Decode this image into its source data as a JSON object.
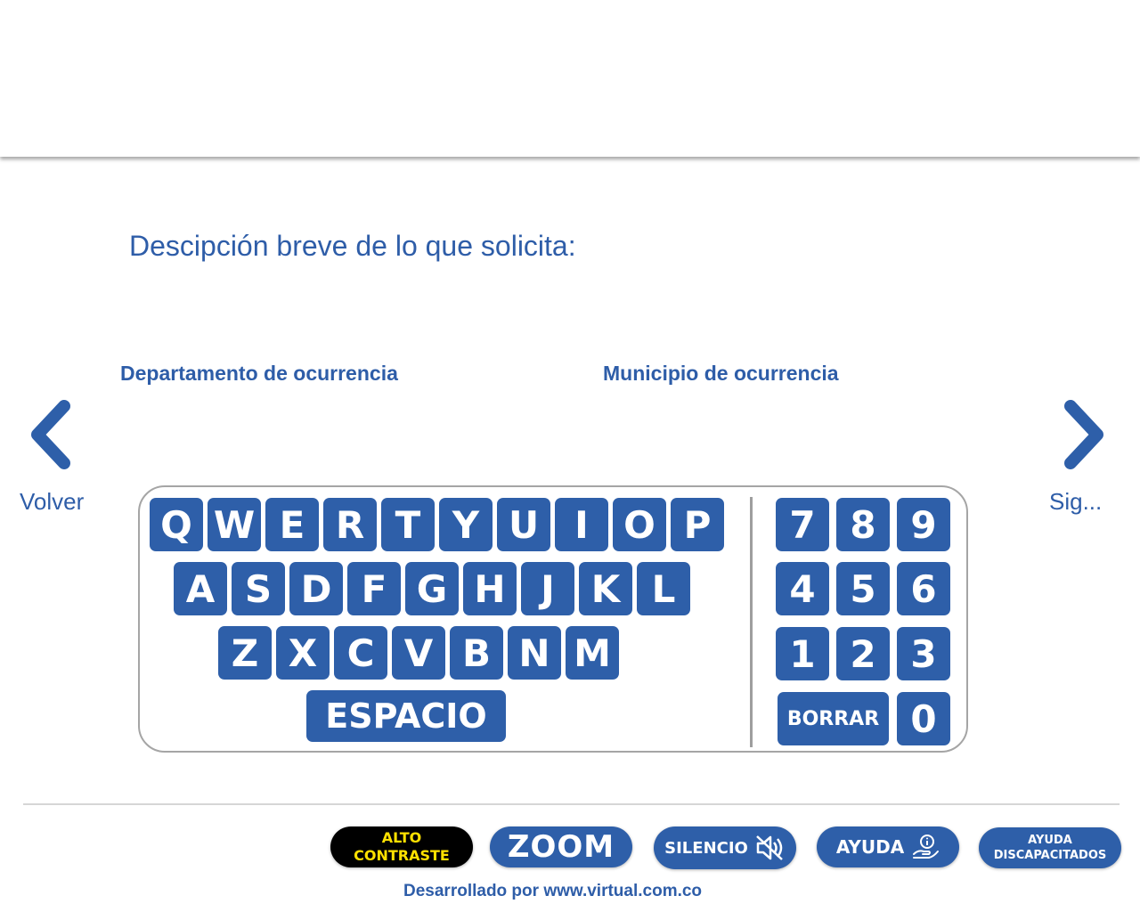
{
  "title": "Descipción breve de lo que solicita:",
  "fields": {
    "departamento_label": "Departamento de ocurrencia",
    "municipio_label": "Municipio de ocurrencia"
  },
  "nav": {
    "back_label": "Volver",
    "next_label": "Sig..."
  },
  "keyboard": {
    "row1": [
      "Q",
      "W",
      "E",
      "R",
      "T",
      "Y",
      "U",
      "I",
      "O",
      "P"
    ],
    "row2": [
      "A",
      "S",
      "D",
      "F",
      "G",
      "H",
      "J",
      "K",
      "L"
    ],
    "row3": [
      "Z",
      "X",
      "C",
      "V",
      "B",
      "N",
      "M"
    ],
    "space_label": "ESPACIO",
    "numpad": [
      "7",
      "8",
      "9",
      "4",
      "5",
      "6",
      "1",
      "2",
      "3"
    ],
    "delete_label": "BORRAR",
    "zero": "0"
  },
  "accessibility": {
    "contrast_line1": "ALTO",
    "contrast_line2": "CONTRASTE",
    "zoom_label": "ZOOM",
    "silence_label": "SILENCIO",
    "help_label": "AYUDA",
    "disability_line1": "AYUDA",
    "disability_line2": "DISCAPACITADOS"
  },
  "footer": {
    "credit": "Desarrollado por www.virtual.com.co"
  },
  "colors": {
    "primary": "#2e5fa9",
    "contrast_bg": "#000000",
    "contrast_text": "#ffe100"
  },
  "icons": {
    "back": "chevron-left-icon",
    "next": "chevron-right-icon",
    "silence": "speaker-muted-icon",
    "help": "hand-info-icon",
    "zoom": "magnifier-icon"
  }
}
